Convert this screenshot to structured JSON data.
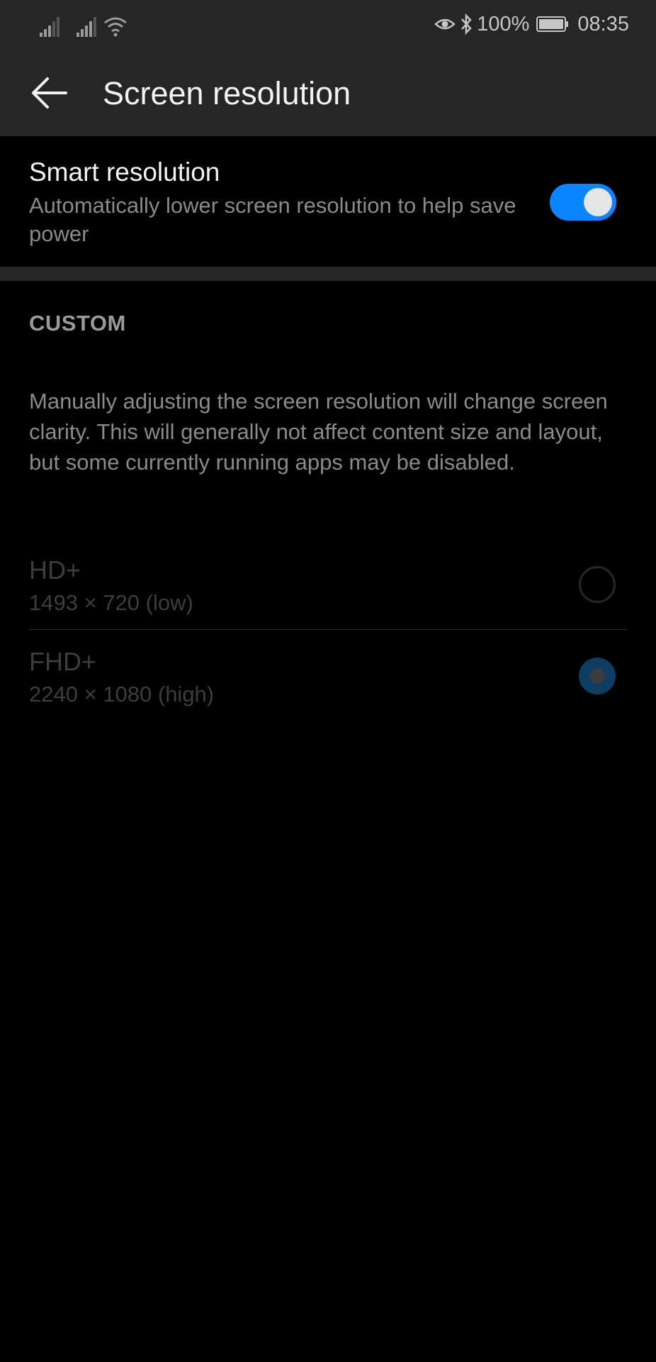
{
  "status_bar": {
    "battery": "100%",
    "time": "08:35",
    "icons": [
      "signal-1-icon",
      "signal-2-icon",
      "wifi-icon",
      "eye-comfort-icon",
      "bluetooth-icon",
      "battery-icon"
    ]
  },
  "app_bar": {
    "back_icon": "arrow-left-icon",
    "title": "Screen resolution"
  },
  "smart_resolution": {
    "title": "Smart resolution",
    "description": "Automatically lower screen resolution to help save power",
    "enabled": true,
    "accent_color": "#0a84ff"
  },
  "custom": {
    "header": "CUSTOM",
    "description": "Manually adjusting the screen resolution will change screen clarity. This will generally not affect content size and layout, but some currently running apps may be disabled.",
    "options": [
      {
        "name": "HD+",
        "detail": "1493 × 720 (low)",
        "selected": false
      },
      {
        "name": "FHD+",
        "detail": "2240 × 1080 (high)",
        "selected": true
      }
    ]
  }
}
